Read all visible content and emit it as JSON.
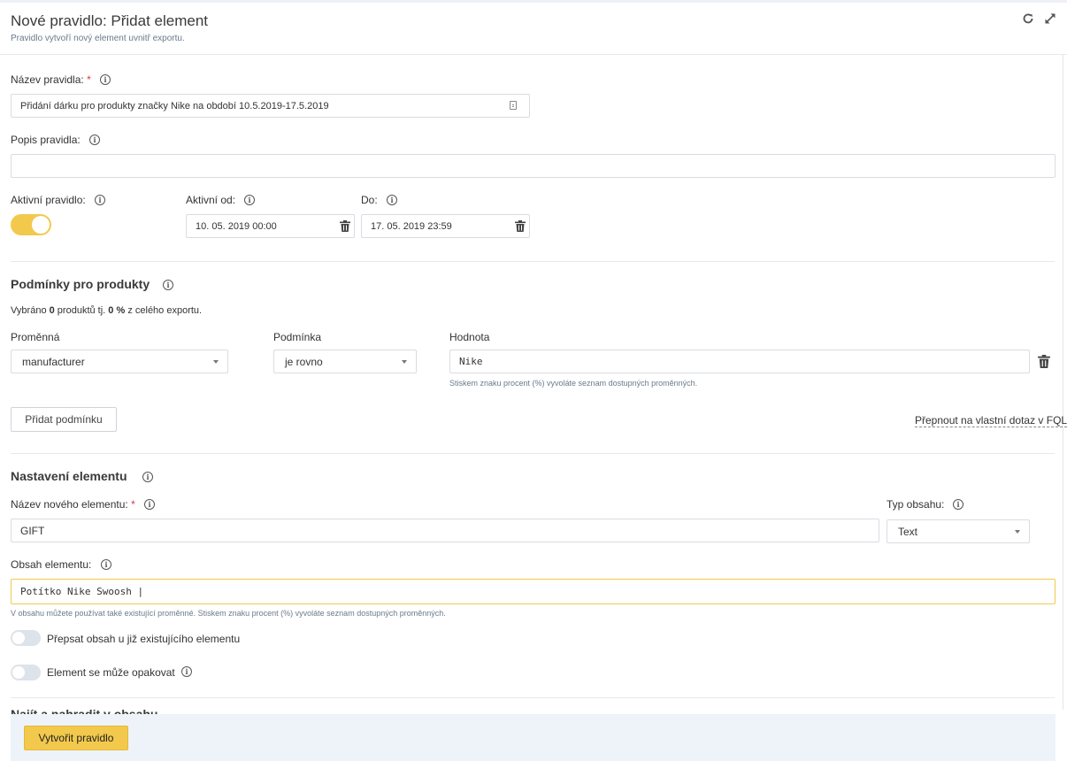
{
  "header": {
    "title": "Nové pravidlo: Přidat element",
    "subtitle": "Pravidlo vytvoří nový element uvnitř exportu.",
    "refresh_icon": "refresh-icon",
    "expand_icon": "expand-icon"
  },
  "rule_name": {
    "label": "Název pravidla:",
    "required_mark": "*",
    "value": "Přidání dárku pro produkty značky Nike na období 10.5.2019-17.5.2019"
  },
  "rule_description": {
    "label": "Popis pravidla:",
    "value": ""
  },
  "active": {
    "label": "Aktivní pravidlo:",
    "enabled": true,
    "from_label": "Aktivní od:",
    "from_value": "10. 05. 2019 00:00",
    "to_label": "Do:",
    "to_value": "17. 05. 2019 23:59"
  },
  "conditions": {
    "title": "Podmínky pro produkty",
    "summary_prefix": "Vybráno ",
    "summary_count": "0",
    "summary_mid": " produktů tj. ",
    "summary_percent": "0 %",
    "summary_suffix": " z celého exportu.",
    "col_variable": "Proměnná",
    "col_condition": "Podmínka",
    "col_value": "Hodnota",
    "row": {
      "variable": "manufacturer",
      "condition": "je rovno",
      "value": "Nike"
    },
    "value_hint": "Stiskem znaku procent (%) vyvoláte seznam dostupných proměnných.",
    "add_button": "Přidat podmínku",
    "fql_link": "Přepnout na vlastní dotaz v FQL"
  },
  "element": {
    "title": "Nastavení elementu",
    "name_label": "Název nového elementu:",
    "required_mark": "*",
    "name_value": "GIFT",
    "type_label": "Typ obsahu:",
    "type_value": "Text",
    "content_label": "Obsah elementu:",
    "content_value": "Potítko Nike Swoosh |",
    "content_hint": "V obsahu můžete používat také existující proměnné. Stiskem znaku procent (%) vyvoláte seznam dostupných proměnných.",
    "overwrite_label": "Přepsat obsah u již existujícího elementu",
    "overwrite_enabled": false,
    "repeat_label": "Element se může opakovat",
    "repeat_enabled": false
  },
  "next_section_title": "Najít a nahradit v obsahu",
  "footer": {
    "create_button": "Vytvořit pravidlo"
  },
  "colors": {
    "accent": "#f2c94c",
    "required": "#e0344a",
    "footer_bg": "#eef3fa"
  }
}
